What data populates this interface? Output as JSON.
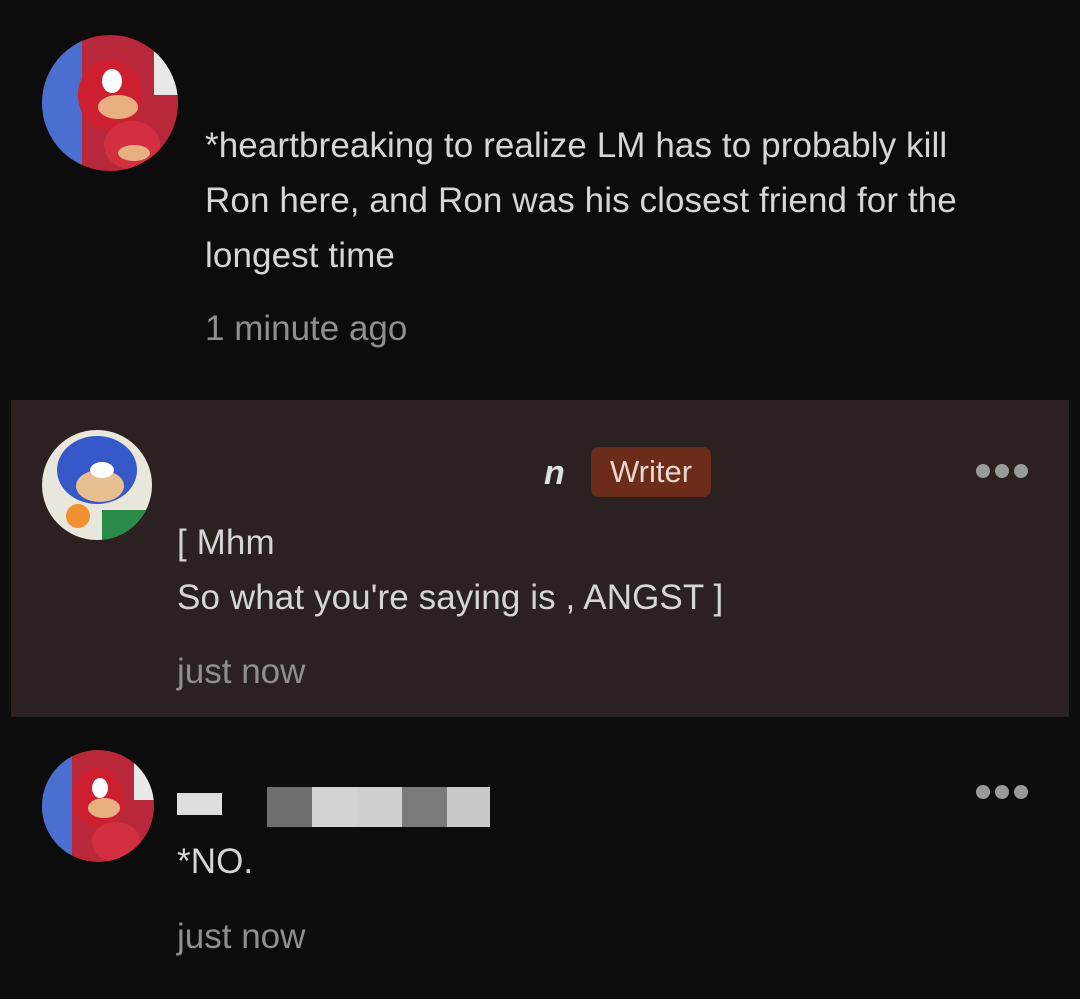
{
  "comments": [
    {
      "text_lines": [
        "*heartbreaking to realize LM has to probably kill",
        "Ron here, and Ron was his closest friend for the",
        "longest time"
      ],
      "time": "1 minute ago"
    },
    {
      "username": "n",
      "badge": "Writer",
      "text_lines": [
        "[ Mhm",
        "So what you're saying is , ANGST ]"
      ],
      "time": "just now"
    },
    {
      "text_lines": [
        "*NO."
      ],
      "time": "just now"
    }
  ],
  "colors": {
    "background": "#0c0c0c",
    "highlight_background": "#2a2120",
    "writer_badge": "#6b2c19"
  }
}
